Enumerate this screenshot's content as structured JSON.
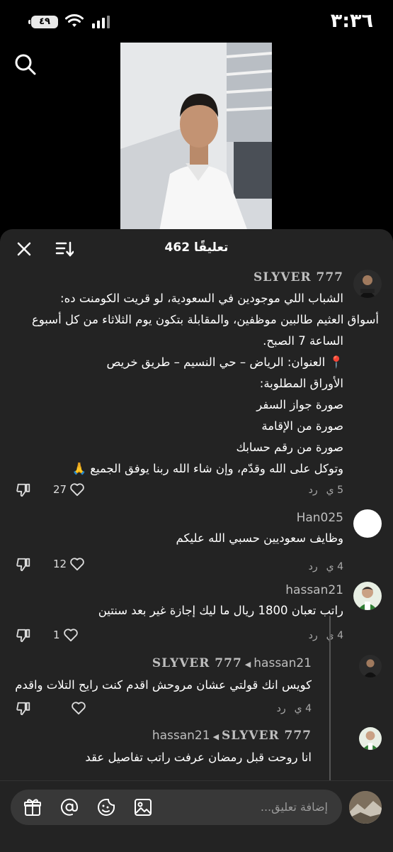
{
  "status_bar": {
    "time": "٣:٣٦",
    "battery": "٤٩"
  },
  "comments_panel": {
    "count_label": "462 تعليقًا",
    "comments": [
      {
        "username": "SLYVER 777",
        "lines": [
          "الشباب اللي موجودين في السعودية، لو قريت الكومنت ده:",
          "أسواق العثيم طالبين موظفين، والمقابلة بتكون يوم الثلاثاء من كل أسبوع",
          "الساعة 7 الصبح.",
          "📍 العنوان: الرياض – حي النسيم – طريق خريص",
          "الأوراق المطلوبة:",
          "صورة جواز السفر",
          "صورة من الإقامة",
          "صورة من رقم حسابك",
          "وتوكل على الله وقدّم، وإن شاء الله ربنا يوفق الجميع 🙏"
        ],
        "time": "5 ي",
        "reply": "رد",
        "likes": "27"
      },
      {
        "username": "Han025",
        "text": "وظايف سعوديين حسبي الله عليكم",
        "time": "4 ي",
        "reply": "رد",
        "likes": "12"
      },
      {
        "username": "hassan21",
        "text": "راتب تعبان 1800 ريال ما ليك إجازة غير بعد سنتين",
        "time": "4 ي",
        "reply": "رد",
        "likes": "1"
      },
      {
        "username": "hassan21",
        "reply_to": "SLYVER 777",
        "text": "كويس انك قولتي عشان مروحش اقدم كنت رايح التلات واقدم",
        "time": "4 ي",
        "reply": "رد"
      },
      {
        "username": "SLYVER 777",
        "reply_to": "hassan21",
        "text": "انا روحت قبل رمضان عرفت راتب تفاصيل عقد"
      }
    ]
  },
  "input_bar": {
    "placeholder": "إضافة تعليق..."
  },
  "colors": {
    "panel_bg": "#232323",
    "input_bg": "#383838",
    "text_secondary": "#aaaaaa"
  }
}
